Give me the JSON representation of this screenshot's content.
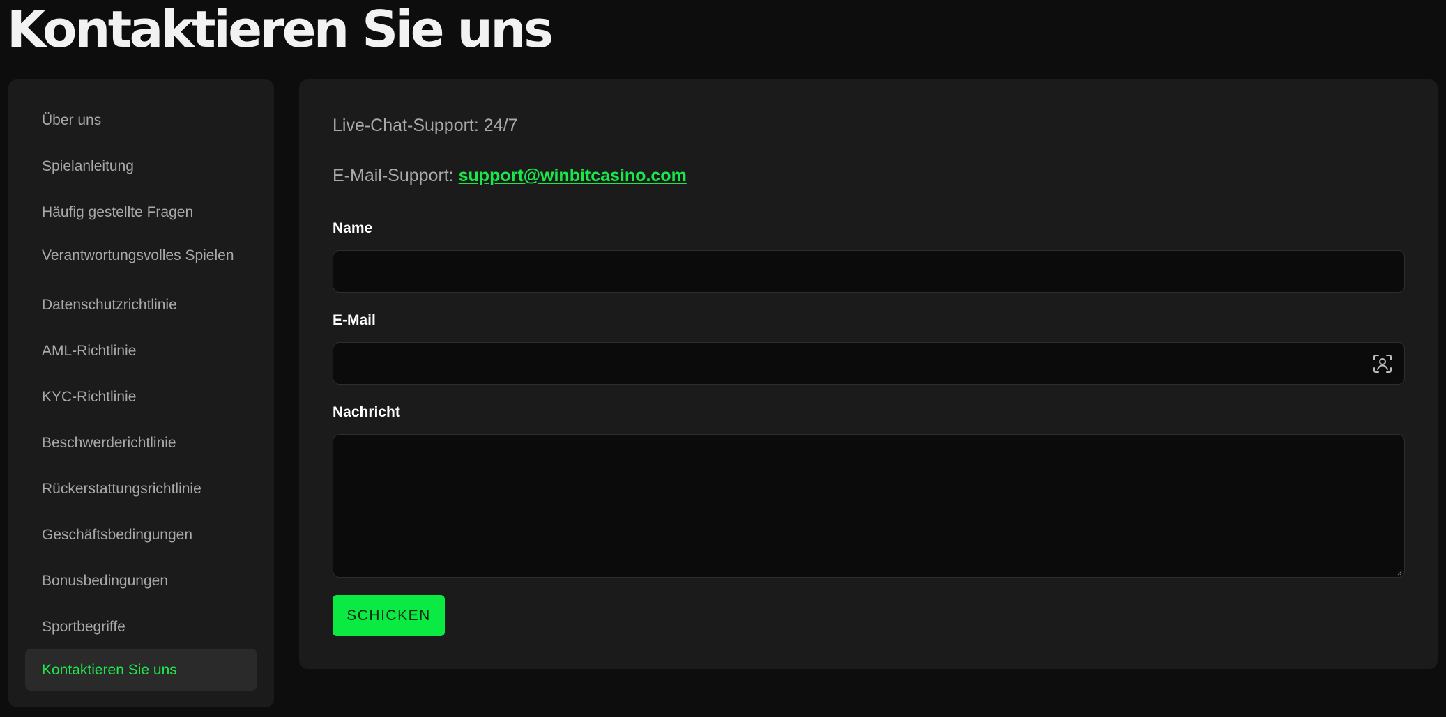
{
  "page": {
    "title": "Kontaktieren Sie uns"
  },
  "sidebar": {
    "items": [
      {
        "label": "Über uns"
      },
      {
        "label": "Spielanleitung"
      },
      {
        "label": "Häufig gestellte Fragen"
      },
      {
        "label": "Verantwortungsvolles Spielen"
      },
      {
        "label": "Datenschutzrichtlinie"
      },
      {
        "label": "AML-Richtlinie"
      },
      {
        "label": "KYC-Richtlinie"
      },
      {
        "label": "Beschwerderichtlinie"
      },
      {
        "label": "Rückerstattungsrichtlinie"
      },
      {
        "label": "Geschäftsbedingungen"
      },
      {
        "label": "Bonusbedingungen"
      },
      {
        "label": "Sportbegriffe"
      },
      {
        "label": "Kontaktieren Sie uns",
        "active": true
      }
    ]
  },
  "contact": {
    "live_chat": "Live-Chat-Support: 24/7",
    "email_prefix": "E-Mail-Support: ",
    "email_address": "support@winbitcasino.com"
  },
  "form": {
    "name_label": "Name",
    "name_value": "",
    "email_label": "E-Mail",
    "email_value": "",
    "email_icon": "autofill-contact-icon",
    "message_label": "Nachricht",
    "message_value": "",
    "submit_label": "SCHICKEN"
  },
  "colors": {
    "accent": "#0aea42",
    "link": "#18e84a",
    "background": "#0d0d0d",
    "panel": "#1b1b1b"
  }
}
